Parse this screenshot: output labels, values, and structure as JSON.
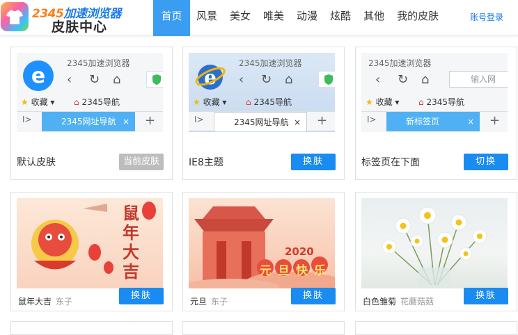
{
  "header": {
    "brand_top_a": "2345",
    "brand_top_b": "加速浏览器",
    "brand_bottom": "皮肤中心",
    "nav": [
      "首页",
      "风景",
      "美女",
      "唯美",
      "动漫",
      "炫酷",
      "其他",
      "我的皮肤"
    ],
    "active_nav": "首页",
    "login": "账号登录"
  },
  "preview": {
    "browser_title": "2345加速浏览器",
    "favorites": "收藏",
    "nav_site": "2345导航",
    "tab_nav": "2345网址导航",
    "tab_new": "新标签页",
    "address_placeholder": "输入网",
    "tab_back": "I>",
    "tab_close": "×",
    "tab_plus": "+"
  },
  "skins": [
    {
      "name": "默认皮肤",
      "button": "当前皮肤",
      "current": true
    },
    {
      "name": "IE8主题",
      "button": "换肤",
      "current": false
    },
    {
      "name": "标签页在下面",
      "button": "切换",
      "current": false
    }
  ],
  "themes": [
    {
      "title": "鼠年大吉",
      "author": "东子",
      "button": "换肤",
      "art_text": "鼠年大吉"
    },
    {
      "title": "元旦",
      "author": "东子",
      "button": "换肤",
      "art_year": "2020",
      "art_text": "元旦快乐"
    },
    {
      "title": "白色雏菊",
      "author": "花蘑菇菇",
      "button": "换肤"
    }
  ],
  "colors": {
    "accent": "#1a8bf0",
    "nav_active": "#3b9df2",
    "login": "#1a7be8"
  }
}
